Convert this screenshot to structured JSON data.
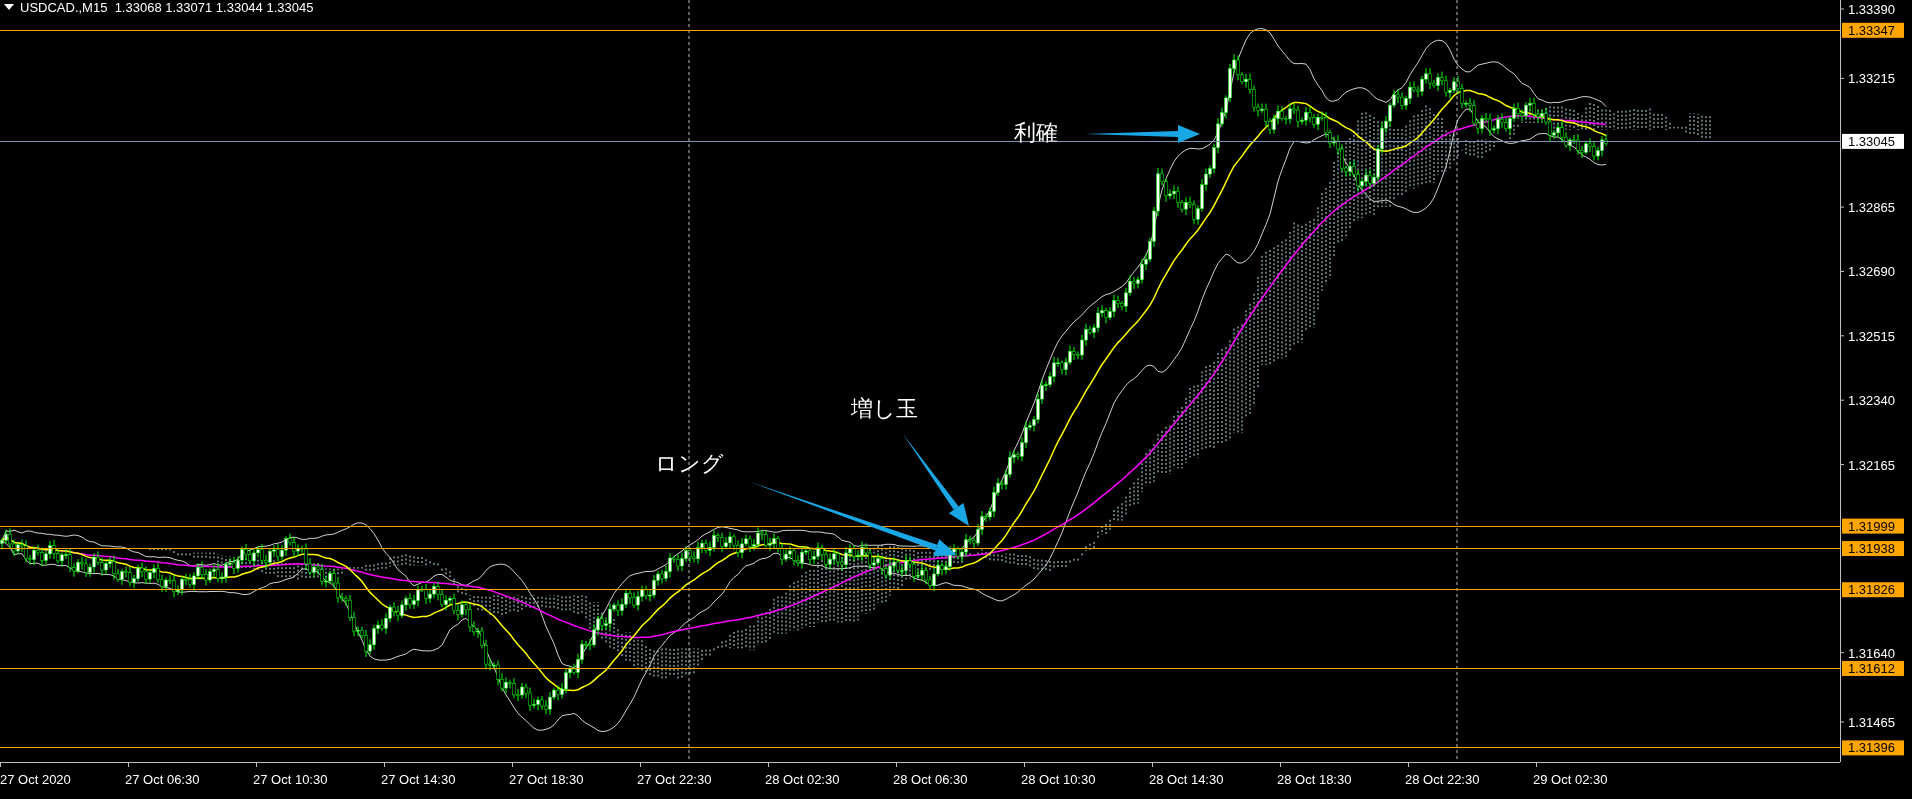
{
  "header": {
    "symbol": "USDCAD.,M15",
    "prices": [
      "1.33068",
      "1.33071",
      "1.33044",
      "1.33045"
    ]
  },
  "price_axis": {
    "ticks": [
      "1.33390",
      "1.33215",
      "1.32865",
      "1.32690",
      "1.32515",
      "1.32340",
      "1.32165",
      "1.31640",
      "1.31465"
    ]
  },
  "levels": [
    {
      "label": "1.33347",
      "kind": "line"
    },
    {
      "label": "1.33045",
      "kind": "bid"
    },
    {
      "label": "1.31999",
      "kind": "line"
    },
    {
      "label": "1.31938",
      "kind": "line"
    },
    {
      "label": "1.31826",
      "kind": "line"
    },
    {
      "label": "1.31612",
      "kind": "line"
    },
    {
      "label": "1.31396",
      "kind": "line"
    }
  ],
  "time_axis": {
    "labels": [
      "27 Oct 2020",
      "27 Oct 06:30",
      "27 Oct 10:30",
      "27 Oct 14:30",
      "27 Oct 18:30",
      "27 Oct 22:30",
      "28 Oct 02:30",
      "28 Oct 06:30",
      "28 Oct 10:30",
      "28 Oct 14:30",
      "28 Oct 18:30",
      "28 Oct 22:30",
      "29 Oct 02:30"
    ]
  },
  "annotations": [
    {
      "text": "利確"
    },
    {
      "text": "増し玉"
    },
    {
      "text": "ロング"
    }
  ]
}
